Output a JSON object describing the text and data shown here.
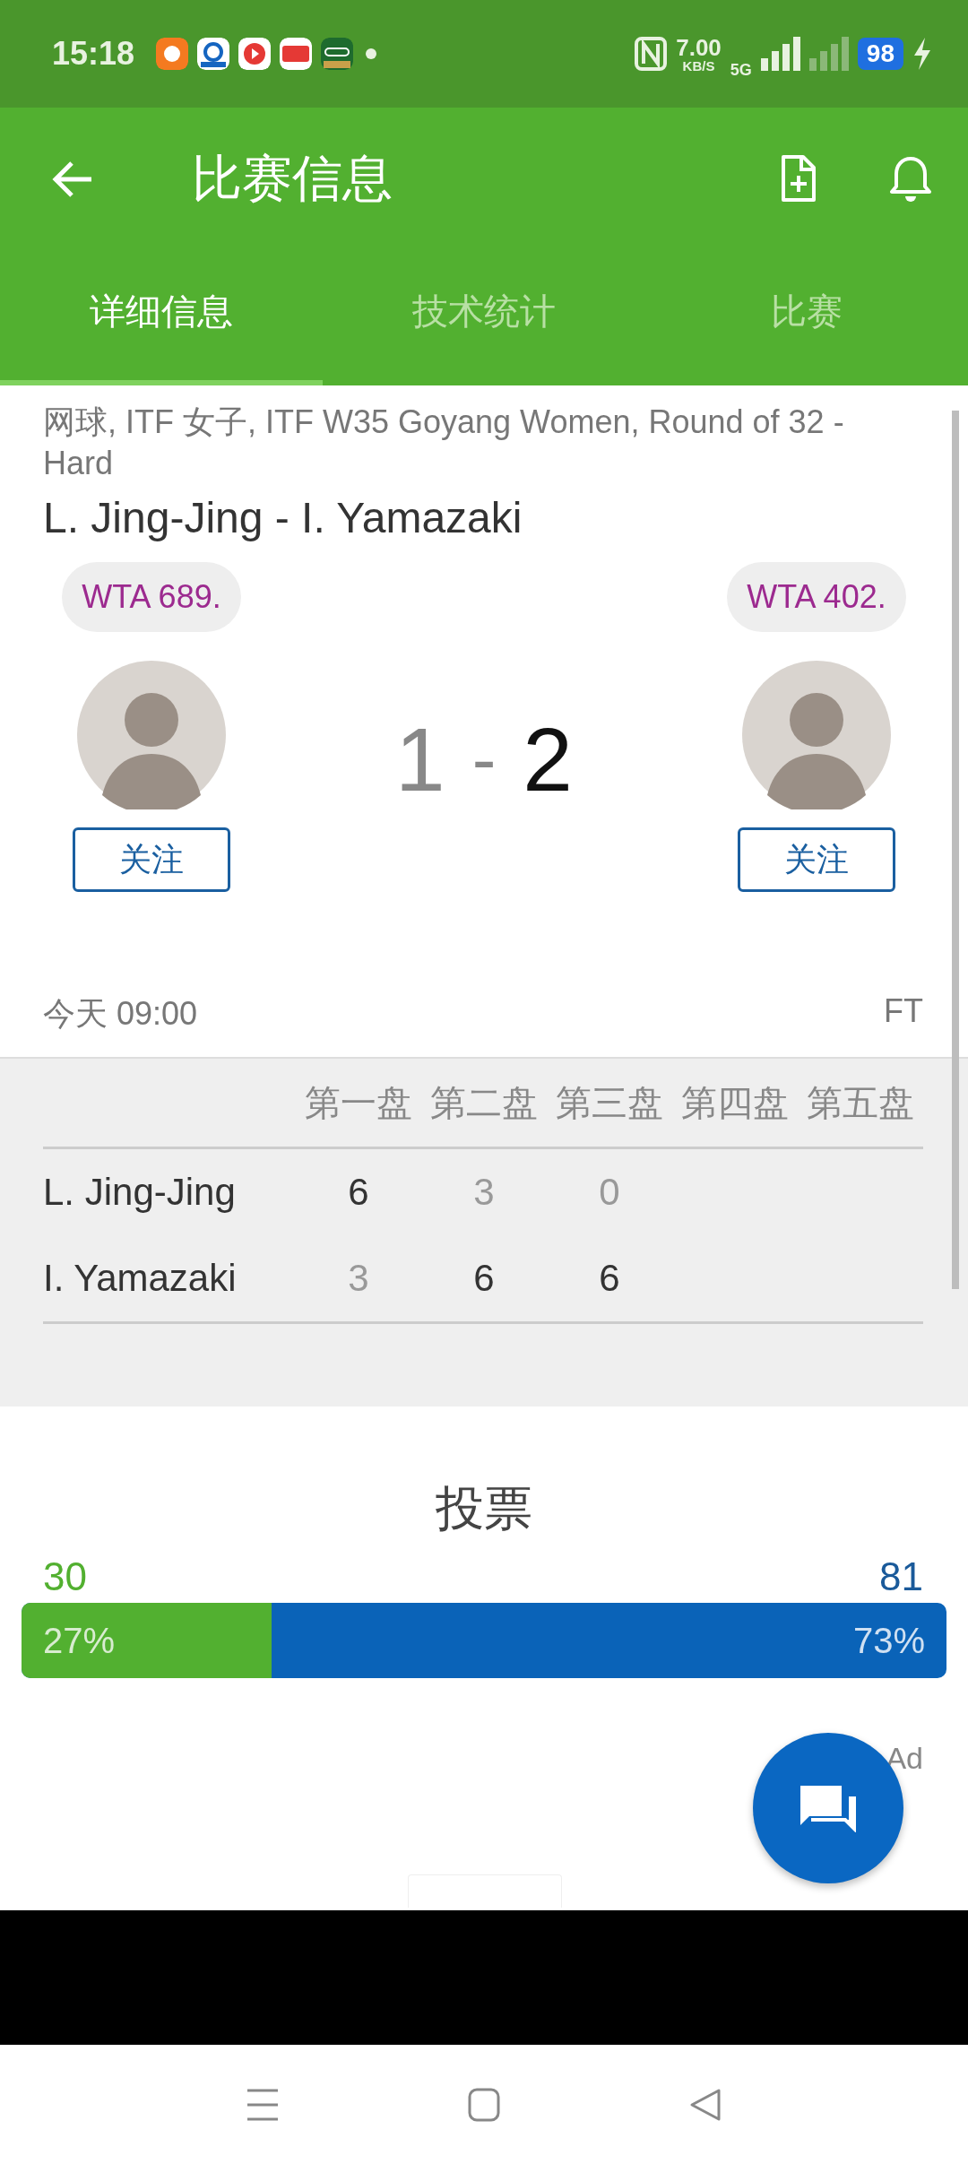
{
  "status_bar": {
    "time": "15:18",
    "speed": "7.00",
    "speed_unit": "KB/S",
    "network": "5G",
    "battery": "98",
    "charging": true
  },
  "app_bar": {
    "title": "比赛信息"
  },
  "tabs": [
    {
      "label": "详细信息",
      "selected": true
    },
    {
      "label": "技术统计",
      "selected": false
    },
    {
      "label": "比赛",
      "selected": false
    }
  ],
  "match": {
    "competition": "网球, ITF 女子, ITF W35 Goyang Women, Round of 32 - Hard",
    "title": "L. Jing-Jing - I. Yamazaki",
    "home": {
      "rank": "WTA 689.",
      "score": "1",
      "winner": false,
      "follow": "关注"
    },
    "score_separator": "-",
    "away": {
      "rank": "WTA 402.",
      "score": "2",
      "winner": true,
      "follow": "关注"
    },
    "date": "今天 09:00",
    "status": "FT"
  },
  "sets": {
    "columns": [
      "第一盘",
      "第二盘",
      "第三盘",
      "第四盘",
      "第五盘"
    ],
    "rows": [
      {
        "name": "L. Jing-Jing",
        "scores": [
          {
            "value": "6",
            "won": true
          },
          {
            "value": "3",
            "won": false
          },
          {
            "value": "0",
            "won": false
          }
        ]
      },
      {
        "name": "I. Yamazaki",
        "scores": [
          {
            "value": "3",
            "won": false
          },
          {
            "value": "6",
            "won": true
          },
          {
            "value": "6",
            "won": true
          }
        ]
      }
    ]
  },
  "vote": {
    "title": "投票",
    "home": {
      "count": "30",
      "percent": "27%"
    },
    "away": {
      "count": "81",
      "percent": "73%"
    },
    "level": 0.27
  },
  "ad": {
    "label": "Ad"
  }
}
